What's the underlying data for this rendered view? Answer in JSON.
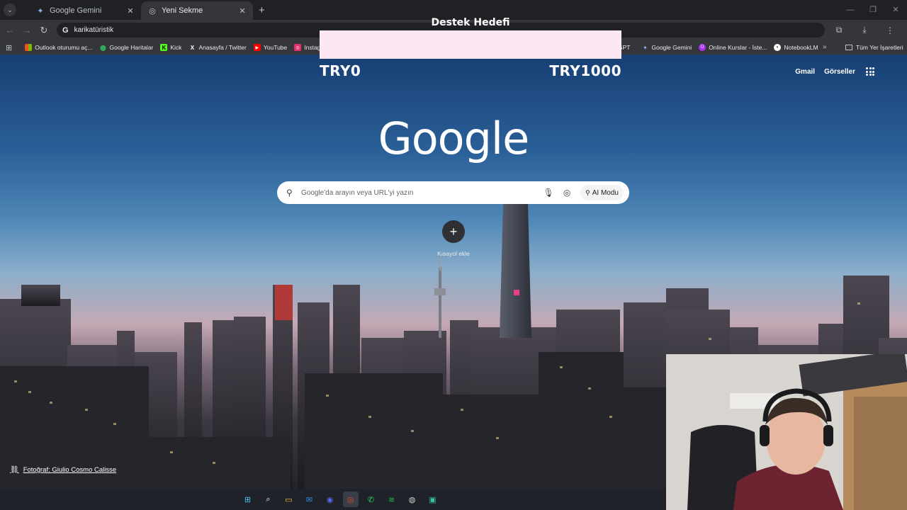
{
  "tabs": [
    {
      "title": "Google Gemini",
      "icon": "gemini-icon",
      "active": false
    },
    {
      "title": "Yeni Sekme",
      "icon": "chrome-icon",
      "active": true
    }
  ],
  "omnibox": {
    "value": "karikatüristik"
  },
  "bookmarks": {
    "left": [
      {
        "label": "Outlook oturumu aç...",
        "icon": "microsoft-icon",
        "color": "#f25022"
      },
      {
        "label": "Google Haritalar",
        "icon": "maps-pin-icon",
        "color": "#34a853"
      },
      {
        "label": "Kick",
        "icon": "kick-icon",
        "color": "#53fc18"
      },
      {
        "label": "Anasayfa / Twitter",
        "icon": "x-icon",
        "color": "#ffffff"
      },
      {
        "label": "YouTube",
        "icon": "youtube-icon",
        "color": "#ff0000"
      },
      {
        "label": "Instagram",
        "icon": "instagram-icon",
        "color": "#e1306c"
      }
    ],
    "right": [
      {
        "label": "GPT",
        "icon": "",
        "color": ""
      },
      {
        "label": "Google Gemini",
        "icon": "gemini-icon",
        "color": "#8ab4f8"
      },
      {
        "label": "Online Kurslar - İste...",
        "icon": "udemy-icon",
        "color": "#a435f0"
      },
      {
        "label": "NotebookLM",
        "icon": "notebooklm-icon",
        "color": "#ffffff"
      }
    ],
    "all_label": "Tüm Yer İşaretleri"
  },
  "google": {
    "gmail": "Gmail",
    "images": "Görseller",
    "logo": "Google",
    "search_placeholder": "Google'da arayın veya URL'yi yazın",
    "ai_mode": "AI Modu",
    "add_shortcut": "Kısayol ekle",
    "photo_credit": "Fotoğraf: Giulio Cosmo Calisse"
  },
  "donation_goal": {
    "title": "Destek Hedefi",
    "min": "TRY0",
    "max": "TRY1000",
    "progress": 0,
    "bar_color": "#fde7f3",
    "fill_color": "#f06292"
  },
  "taskbar": [
    {
      "name": "windows-start-icon",
      "color": "#4cc2ff",
      "glyph": "⊞",
      "active": false
    },
    {
      "name": "search-icon",
      "color": "#ffffff",
      "glyph": "⌕",
      "active": false
    },
    {
      "name": "file-explorer-icon",
      "color": "#f6c342",
      "glyph": "▭",
      "active": false
    },
    {
      "name": "mail-icon",
      "color": "#2f8de4",
      "glyph": "✉",
      "active": false
    },
    {
      "name": "discord-icon",
      "color": "#5865f2",
      "glyph": "◉",
      "active": false
    },
    {
      "name": "chrome-icon",
      "color": "#ea4335",
      "glyph": "◎",
      "active": true
    },
    {
      "name": "whatsapp-icon",
      "color": "#25d366",
      "glyph": "✆",
      "active": false
    },
    {
      "name": "spotify-icon",
      "color": "#1db954",
      "glyph": "≋",
      "active": false
    },
    {
      "name": "obs-icon",
      "color": "#d0d0d0",
      "glyph": "◍",
      "active": false
    },
    {
      "name": "streamlabs-icon",
      "color": "#31c3a2",
      "glyph": "▣",
      "active": false
    }
  ]
}
